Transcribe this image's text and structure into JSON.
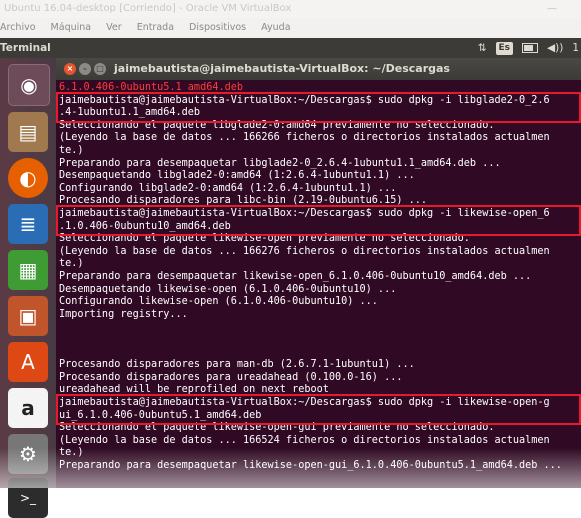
{
  "host": {
    "title": "Ubuntu 16.04-desktop [Corriendo] - Oracle VM VirtualBox",
    "menu": [
      "Archivo",
      "Máquina",
      "Ver",
      "Entrada",
      "Dispositivos",
      "Ayuda"
    ]
  },
  "panel": {
    "app_name": "Terminal",
    "keyboard_layout": "Es",
    "time_partial": "1",
    "icons": [
      "network-icon",
      "keyboard-icon",
      "battery-icon",
      "volume-icon"
    ]
  },
  "launcher": {
    "items": [
      "dash-icon",
      "files-icon",
      "firefox-icon",
      "writer-icon",
      "calc-icon",
      "impress-icon",
      "software-center-icon",
      "amazon-icon",
      "settings-icon",
      "terminal-icon"
    ],
    "amazon_glyph": "a"
  },
  "terminal": {
    "title": "jaimebautista@jaimebautista-VirtualBox: ~/Descargas",
    "lines": [
      "6.1.0.406-0ubuntu5.1_amd64.deb",
      "jaimebautista@jaimebautista-VirtualBox:~/Descargas$ sudo dpkg -i libglade2-0_2.6",
      ".4-1ubuntu1.1_amd64.deb",
      "Seleccionando el paquete libglade2-0:amd64 previamente no seleccionado.",
      "(Leyendo la base de datos ... 166266 ficheros o directorios instalados actualmen",
      "te.)",
      "Preparando para desempaquetar libglade2-0_2.6.4-1ubuntu1.1_amd64.deb ...",
      "Desempaquetando libglade2-0:amd64 (1:2.6.4-1ubuntu1.1) ...",
      "Configurando libglade2-0:amd64 (1:2.6.4-1ubuntu1.1) ...",
      "Procesando disparadores para libc-bin (2.19-0ubuntu6.15) ...",
      "jaimebautista@jaimebautista-VirtualBox:~/Descargas$ sudo dpkg -i likewise-open_6",
      ".1.0.406-0ubuntu10_amd64.deb",
      "Seleccionando el paquete likewise-open previamente no seleccionado.",
      "(Leyendo la base de datos ... 166276 ficheros o directorios instalados actualmen",
      "te.)",
      "Preparando para desempaquetar likewise-open_6.1.0.406-0ubuntu10_amd64.deb ...",
      "Desempaquetando likewise-open (6.1.0.406-0ubuntu10) ...",
      "Configurando likewise-open (6.1.0.406-0ubuntu10) ...",
      "Importing registry...",
      "",
      "Procesando disparadores para man-db (2.6.7.1-1ubuntu1) ...",
      "Procesando disparadores para ureadahead (0.100.0-16) ...",
      "ureadahead will be reprofiled on next reboot",
      "jaimebautista@jaimebautista-VirtualBox:~/Descargas$ sudo dpkg -i likewise-open-g",
      "ui_6.1.0.406-0ubuntu5.1_amd64.deb",
      "Seleccionando el paquete likewise-open-gui previamente no seleccionado.",
      "(Leyendo la base de datos ... 166524 ficheros o directorios instalados actualmen",
      "te.)",
      "Preparando para desempaquetar likewise-open-gui_6.1.0.406-0ubuntu5.1_amd64.deb ..."
    ]
  },
  "colors": {
    "terminal_bg": "#300a24",
    "highlight_box": "#e8192c",
    "panel_bg": "#3c3b37"
  }
}
